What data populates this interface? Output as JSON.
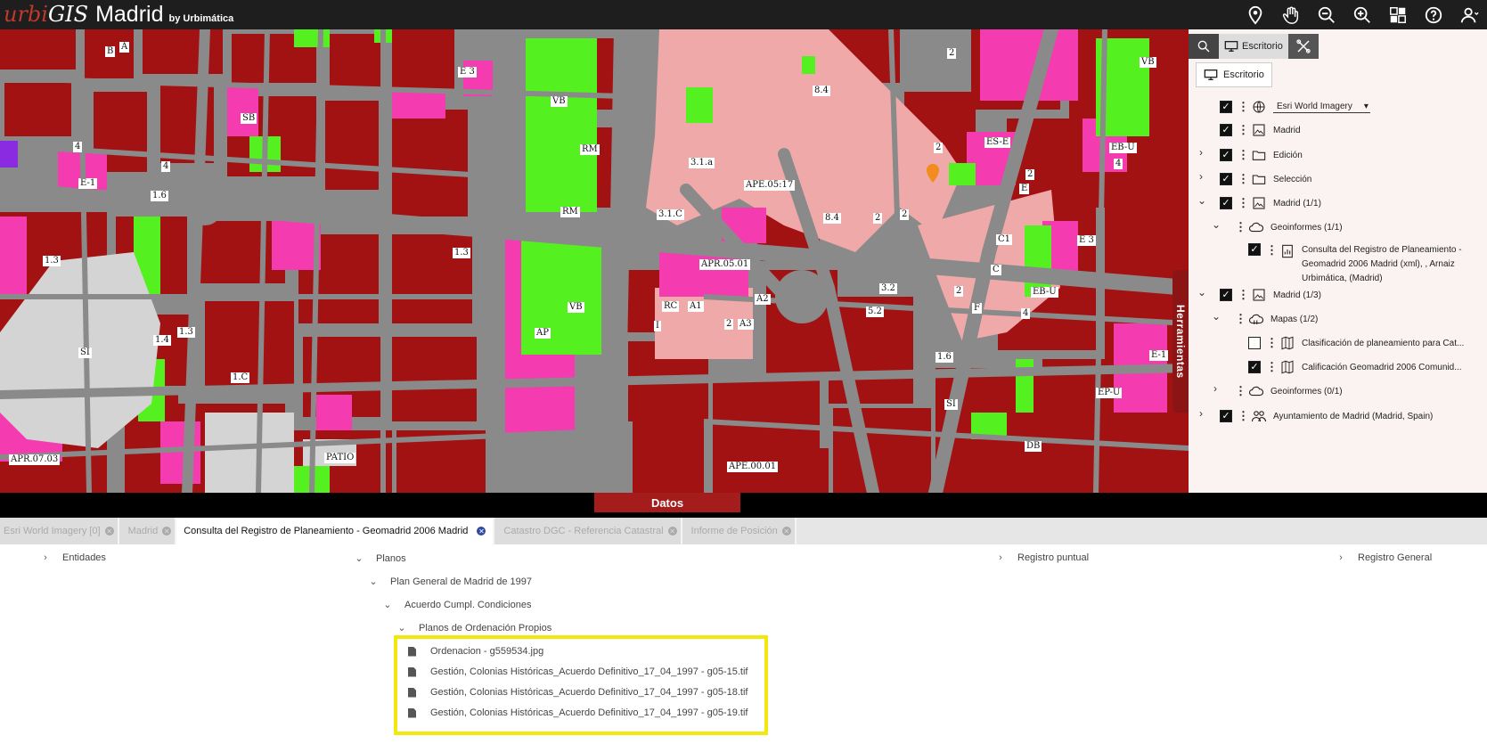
{
  "app": {
    "logo_urbi": "urbi",
    "logo_gis": "GIS",
    "city": "Madrid",
    "by": "by Urbimática"
  },
  "toolbar_icons": [
    "location-pin-icon",
    "pan-hand-icon",
    "zoom-out-icon",
    "zoom-in-icon",
    "basemap-icon",
    "help-icon",
    "user-icon"
  ],
  "map_labels": [
    "B",
    "A",
    "E 3",
    "VB",
    "SB",
    "4",
    "4",
    "E-1",
    "1.6",
    "1.3",
    "RM",
    "RM",
    "3.1.a",
    "APE.05:17",
    "3.1.C",
    "8.4",
    "8.4",
    "2",
    "2",
    "2",
    "2",
    "ES-E",
    "2",
    "E",
    "EB-U",
    "4",
    "VB",
    "E 3",
    "C1",
    "C",
    "APR.05.01",
    "1.3",
    "VB",
    "AP",
    "RC",
    "A1",
    "A2",
    "2",
    "A3",
    "I",
    "3.2",
    "5.2",
    "2",
    "F",
    "4",
    "EB-U",
    "1.4",
    "1.3",
    "SI",
    "1.C",
    "1.6",
    "SI",
    "EP-U",
    "E-1",
    "APR.07.03",
    "PATIO",
    "APE.00.01",
    "DB"
  ],
  "panel": {
    "tab_desktop": "Escritorio",
    "sub_desktop": "Escritorio",
    "herramientas": "Herramientas",
    "basemap": "Esri World Imagery",
    "layers": [
      {
        "label": "Madrid"
      },
      {
        "label": "Edición"
      },
      {
        "label": "Selección"
      },
      {
        "label": "Madrid (1/1)"
      },
      {
        "label": "Geoinformes  (1/1)"
      },
      {
        "label_lines": [
          "Consulta del Registro de Planeamiento -",
          "Geomadrid 2006 Madrid (xml), , Arnaiz",
          "Urbimática, (Madrid)"
        ]
      },
      {
        "label": "Madrid (1/3)"
      },
      {
        "label": "Mapas (1/2)"
      },
      {
        "label": "Clasificación de planeamiento para Cat..."
      },
      {
        "label": "Calificación Geomadrid 2006 Comunid..."
      },
      {
        "label": "Geoinformes  (0/1)"
      },
      {
        "label": "Ayuntamiento de Madrid (Madrid, Spain)"
      }
    ]
  },
  "bottom": {
    "datos": "Datos",
    "tabs": [
      {
        "label": "Esri World Imagery [0]",
        "active": false
      },
      {
        "label": "Madrid",
        "active": false
      },
      {
        "label": "Consulta del Registro de Planeamiento - Geomadrid 2006 Madrid",
        "active": true
      },
      {
        "label": "Catastro DGC - Referencia Catastral",
        "active": false
      },
      {
        "label": "Informe de Posición",
        "active": false
      }
    ],
    "sections": {
      "entidades": "Entidades",
      "planos": "Planos",
      "registro_puntual": "Registro puntual",
      "registro_general": "Registro General"
    },
    "tree": {
      "plan": "Plan General de Madrid de 1997",
      "acuerdo": "Acuerdo Cumpl. Condiciones",
      "planos_ord": "Planos de Ordenación Propios"
    },
    "files": [
      "Ordenacion - g559534.jpg",
      "Gestión, Colonias Históricas_Acuerdo Definitivo_17_04_1997 - g05-15.tif",
      "Gestión, Colonias Históricas_Acuerdo Definitivo_17_04_1997 - g05-18.tif",
      "Gestión, Colonias Históricas_Acuerdo Definitivo_17_04_1997 - g05-19.tif"
    ]
  },
  "colors": {
    "topbar": "#1e1e1e",
    "block_dark": "#a31212",
    "block_pink": "#f43bb0",
    "block_light": "#efa9a9",
    "green": "#55f020",
    "grey_area": "#d4d4d4",
    "datos_tab": "#a51c1c",
    "highlight_box": "#f3e80c"
  }
}
